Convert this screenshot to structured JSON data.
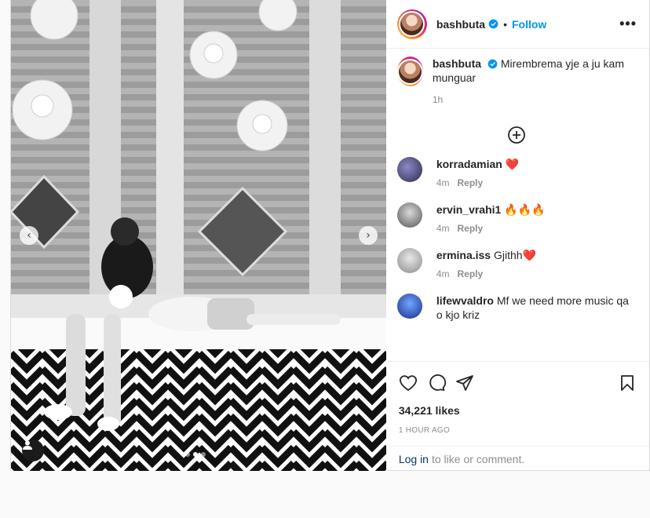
{
  "post": {
    "username": "bashbuta",
    "follow_label": "Follow",
    "separator": "•",
    "more_label": "•••",
    "caption_text": "Mirembrema yje a ju kam munguar",
    "caption_time": "1h",
    "photo_count": 3,
    "current_photo": 2
  },
  "comments": [
    {
      "user": "korradamian",
      "text": "❤️",
      "time": "4m",
      "reply": "Reply",
      "avatar_color": "#2b2b4a"
    },
    {
      "user": "ervin_vrahi1",
      "text": "🔥🔥🔥",
      "time": "4m",
      "reply": "Reply",
      "avatar_color": "#6e6e6e"
    },
    {
      "user": "ermina.iss",
      "text": "Gjithh❤️",
      "time": "4m",
      "reply": "Reply",
      "avatar_color": "#9a9a9a"
    },
    {
      "user": "lifewvaldro",
      "text": "Mf we need more music qa o kjo kriz",
      "time": "",
      "reply": "",
      "avatar_color": "#2a3fb0"
    }
  ],
  "stats": {
    "likes": "34,221 likes",
    "ago": "1 HOUR AGO"
  },
  "login": {
    "link": "Log in",
    "rest": "to like or comment."
  },
  "icons": {
    "prev": "chevron-left-icon",
    "next": "chevron-right-icon",
    "tag": "user-tag-icon",
    "load_more": "plus-circle-icon",
    "like": "heart-icon",
    "comment": "comment-icon",
    "share": "paper-plane-icon",
    "save": "bookmark-icon",
    "verified": "verified-badge-icon"
  },
  "colors": {
    "accent": "#0095f6",
    "link": "#00376b",
    "muted": "#8e8e8e",
    "text": "#262626"
  }
}
